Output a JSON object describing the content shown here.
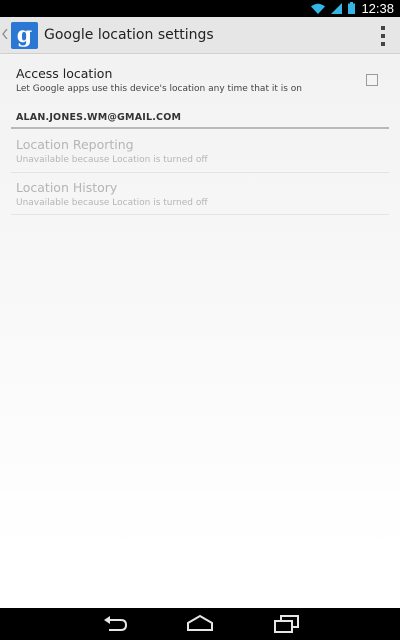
{
  "status_bar": {
    "time": "12:38",
    "icons": [
      "wifi-icon",
      "signal-icon",
      "battery-icon"
    ]
  },
  "action_bar": {
    "title": "Google location settings",
    "logo_glyph": "g",
    "up_icon": "chevron-left-icon",
    "menu_icon": "overflow-menu-icon"
  },
  "access_location": {
    "title": "Access location",
    "summary": "Let Google apps use this device's location any time that it is on",
    "checked": false
  },
  "account": {
    "email": "ALAN.JONES.WM@GMAIL.COM"
  },
  "location_reporting": {
    "title": "Location Reporting",
    "summary": "Unavailable because Location is turned off",
    "enabled": false
  },
  "location_history": {
    "title": "Location History",
    "summary": "Unavailable because Location is turned off",
    "enabled": false
  },
  "nav_bar": {
    "buttons": [
      "back-icon",
      "home-icon",
      "recent-apps-icon"
    ]
  },
  "colors": {
    "logo_blue": "#2a78d4",
    "action_bar_bg": "#e6e6e6",
    "disabled_text": "#b5b5b5"
  }
}
